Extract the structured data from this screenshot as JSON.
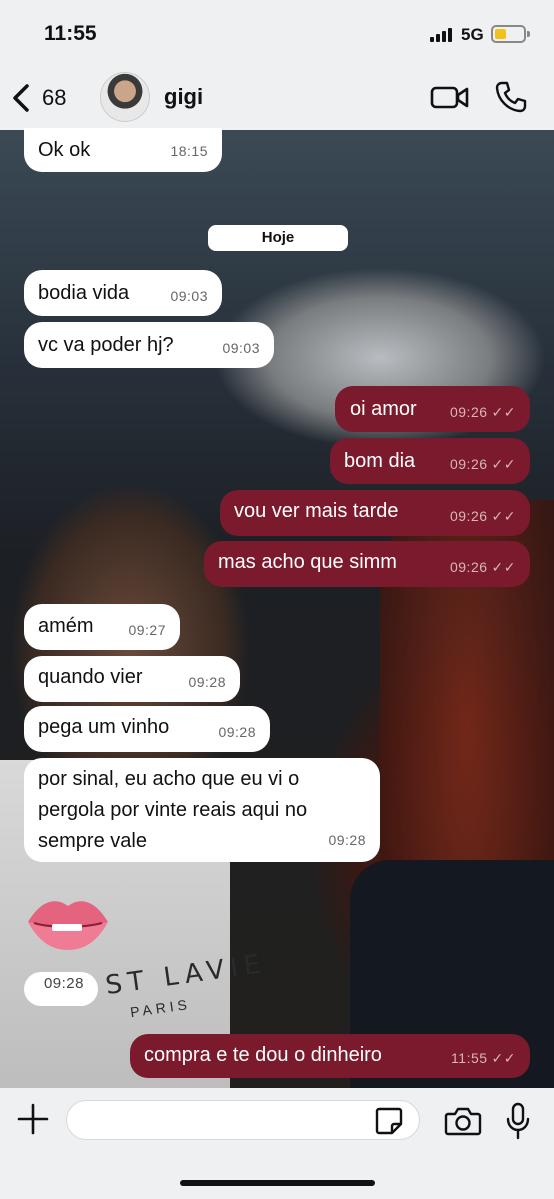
{
  "status_bar": {
    "time": "11:55",
    "network": "5G",
    "battery_level": 0.3,
    "battery_color": "#f2c21a"
  },
  "header": {
    "back_count": "68",
    "contact_name": "gigi",
    "icons": [
      "chevron-left-icon",
      "video-camera-icon",
      "phone-icon"
    ]
  },
  "date_separator": "Hoje",
  "messages": [
    {
      "dir": "in",
      "text": "Ok ok",
      "time": "18:15"
    },
    {
      "dir": "in",
      "text": "bodia vida",
      "time": "09:03"
    },
    {
      "dir": "in",
      "text": "vc va poder hj?",
      "time": "09:03"
    },
    {
      "dir": "out",
      "text": "oi amor",
      "time": "09:26",
      "ticks": "✓✓"
    },
    {
      "dir": "out",
      "text": "bom dia",
      "time": "09:26",
      "ticks": "✓✓"
    },
    {
      "dir": "out",
      "text": "vou ver mais tarde",
      "time": "09:26",
      "ticks": "✓✓"
    },
    {
      "dir": "out",
      "text": "mas acho que simm",
      "time": "09:26",
      "ticks": "✓✓"
    },
    {
      "dir": "in",
      "text": "amém",
      "time": "09:27"
    },
    {
      "dir": "in",
      "text": "quando vier",
      "time": "09:28"
    },
    {
      "dir": "in",
      "text": "pega um vinho",
      "time": "09:28"
    },
    {
      "dir": "in",
      "text": "por sinal, eu acho que eu vi o\npergola por vinte reais aqui no\nsempre vale",
      "time": "09:28"
    },
    {
      "dir": "in",
      "text": "",
      "time": "09:28",
      "sticker": "lips-sticker"
    },
    {
      "dir": "out",
      "text": "compra e te dou o dinheiro",
      "time": "11:55",
      "ticks": "✓✓"
    }
  ],
  "wallpaper_text": {
    "shirt_line1": "ST LAVIE",
    "shirt_line2": "PARIS"
  },
  "input_bar": {
    "placeholder": "",
    "icons": [
      "plus-icon",
      "sticker-icon",
      "camera-icon",
      "microphone-icon"
    ]
  },
  "colors": {
    "outgoing_bubble": "#7b1a2c",
    "incoming_bubble": "#ffffff",
    "bars_background": "#eef0f2"
  }
}
